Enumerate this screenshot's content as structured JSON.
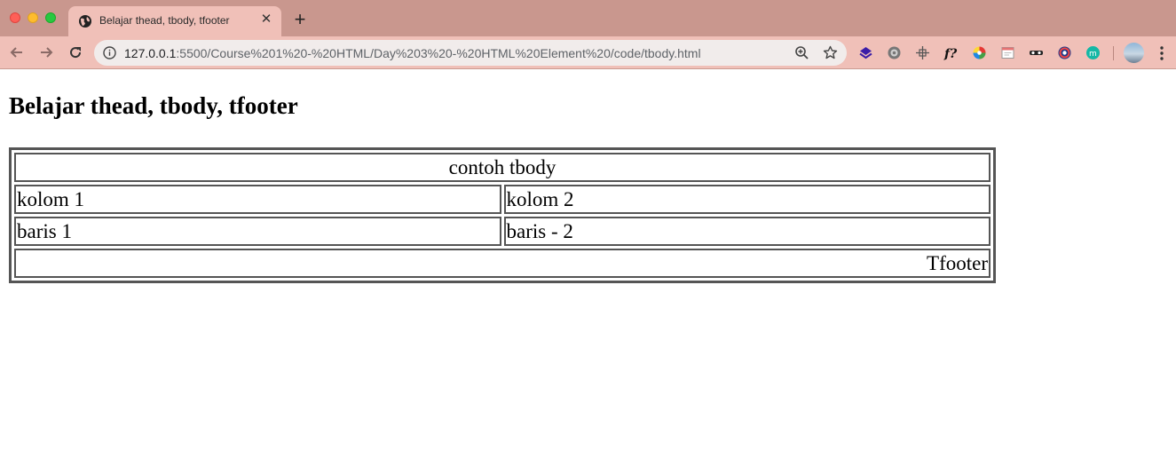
{
  "browser": {
    "tab": {
      "title": "Belajar thead, tbody, tfooter",
      "close_glyph": "✕"
    },
    "new_tab_glyph": "+",
    "url": {
      "host": "127.0.0.1",
      "path": ":5500/Course%201%20-%20HTML/Day%203%20-%20HTML%20Element%20/code/tbody.html"
    },
    "extension_icons": [
      "layers-icon",
      "gear-badge-icon",
      "move-cross-icon",
      "font-question-icon",
      "color-wheel-icon",
      "calendar-icon",
      "incognito-mask-icon",
      "circle-ring-icon",
      "m-circle-icon"
    ],
    "colors": {
      "tabstrip": "#c9978e",
      "active_tab": "#f0c0b8",
      "omnibox": "#f1eceb"
    }
  },
  "page": {
    "title": "Belajar thead, tbody, tfooter",
    "table": {
      "header": "contoh tbody",
      "rows": [
        [
          "kolom 1",
          "kolom 2"
        ],
        [
          "baris 1",
          "baris - 2"
        ]
      ],
      "footer": "Tfooter"
    }
  }
}
